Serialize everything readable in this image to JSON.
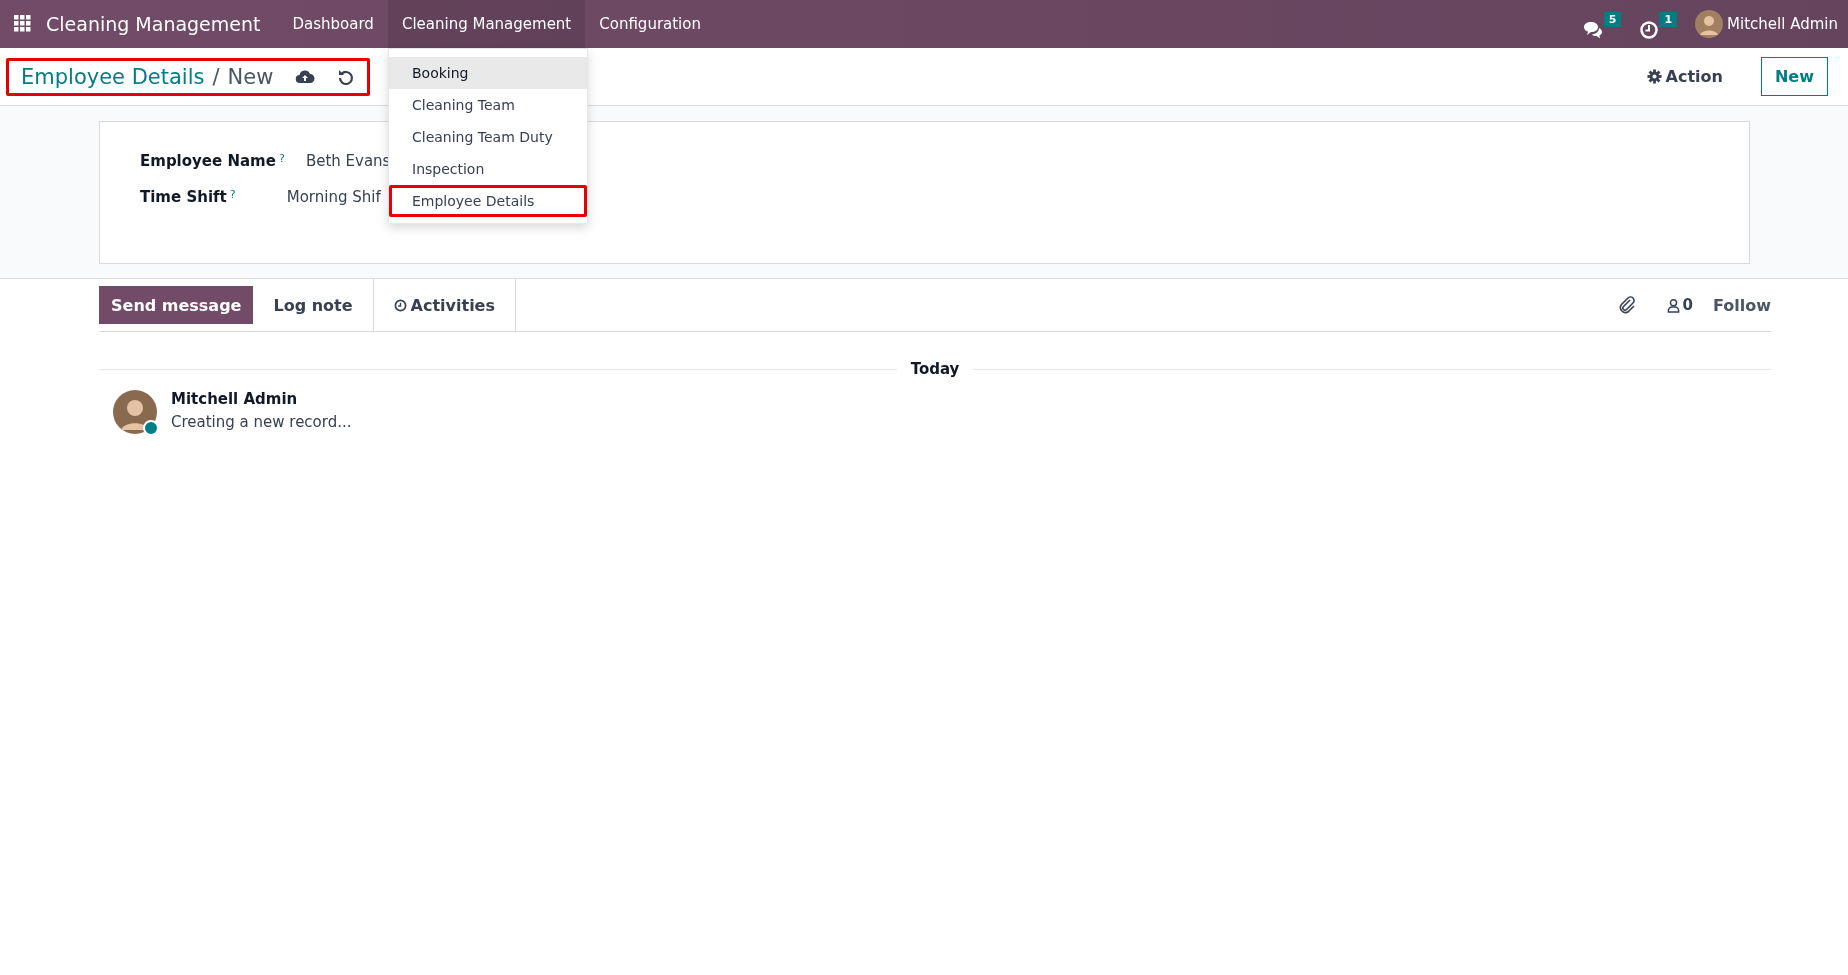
{
  "navbar": {
    "app_name": "Cleaning Management",
    "menus": [
      {
        "label": "Dashboard",
        "selected": false
      },
      {
        "label": "Cleaning Management",
        "selected": true
      },
      {
        "label": "Configuration",
        "selected": false
      }
    ],
    "messages_count": "5",
    "activities_count": "1",
    "user": "Mitchell Admin"
  },
  "dropdown": {
    "items": [
      {
        "label": "Booking",
        "hovered": true,
        "highlighted": false
      },
      {
        "label": "Cleaning Team",
        "hovered": false,
        "highlighted": false
      },
      {
        "label": "Cleaning Team Duty",
        "hovered": false,
        "highlighted": false
      },
      {
        "label": "Inspection",
        "hovered": false,
        "highlighted": false
      },
      {
        "label": "Employee Details",
        "hovered": false,
        "highlighted": true
      }
    ]
  },
  "breadcrumb": {
    "parent": "Employee Details",
    "separator": "/",
    "current": "New",
    "highlighted": true
  },
  "control_panel": {
    "action": "Action",
    "new_button": "New"
  },
  "form": {
    "fields": [
      {
        "label": "Employee Name",
        "help": "?",
        "value": "Beth Evans"
      },
      {
        "label": "Time Shift",
        "help": "?",
        "value": "Morning Shif"
      }
    ]
  },
  "chatter": {
    "tabs": [
      {
        "label": "Send message",
        "selected": true
      },
      {
        "label": "Log note",
        "selected": false
      },
      {
        "label": "Activities",
        "selected": false
      }
    ],
    "followers_count": "0",
    "follow": "Follow",
    "date_separator": "Today",
    "messages": [
      {
        "author": "Mitchell Admin",
        "body": "Creating a new record...",
        "online": true
      }
    ]
  }
}
